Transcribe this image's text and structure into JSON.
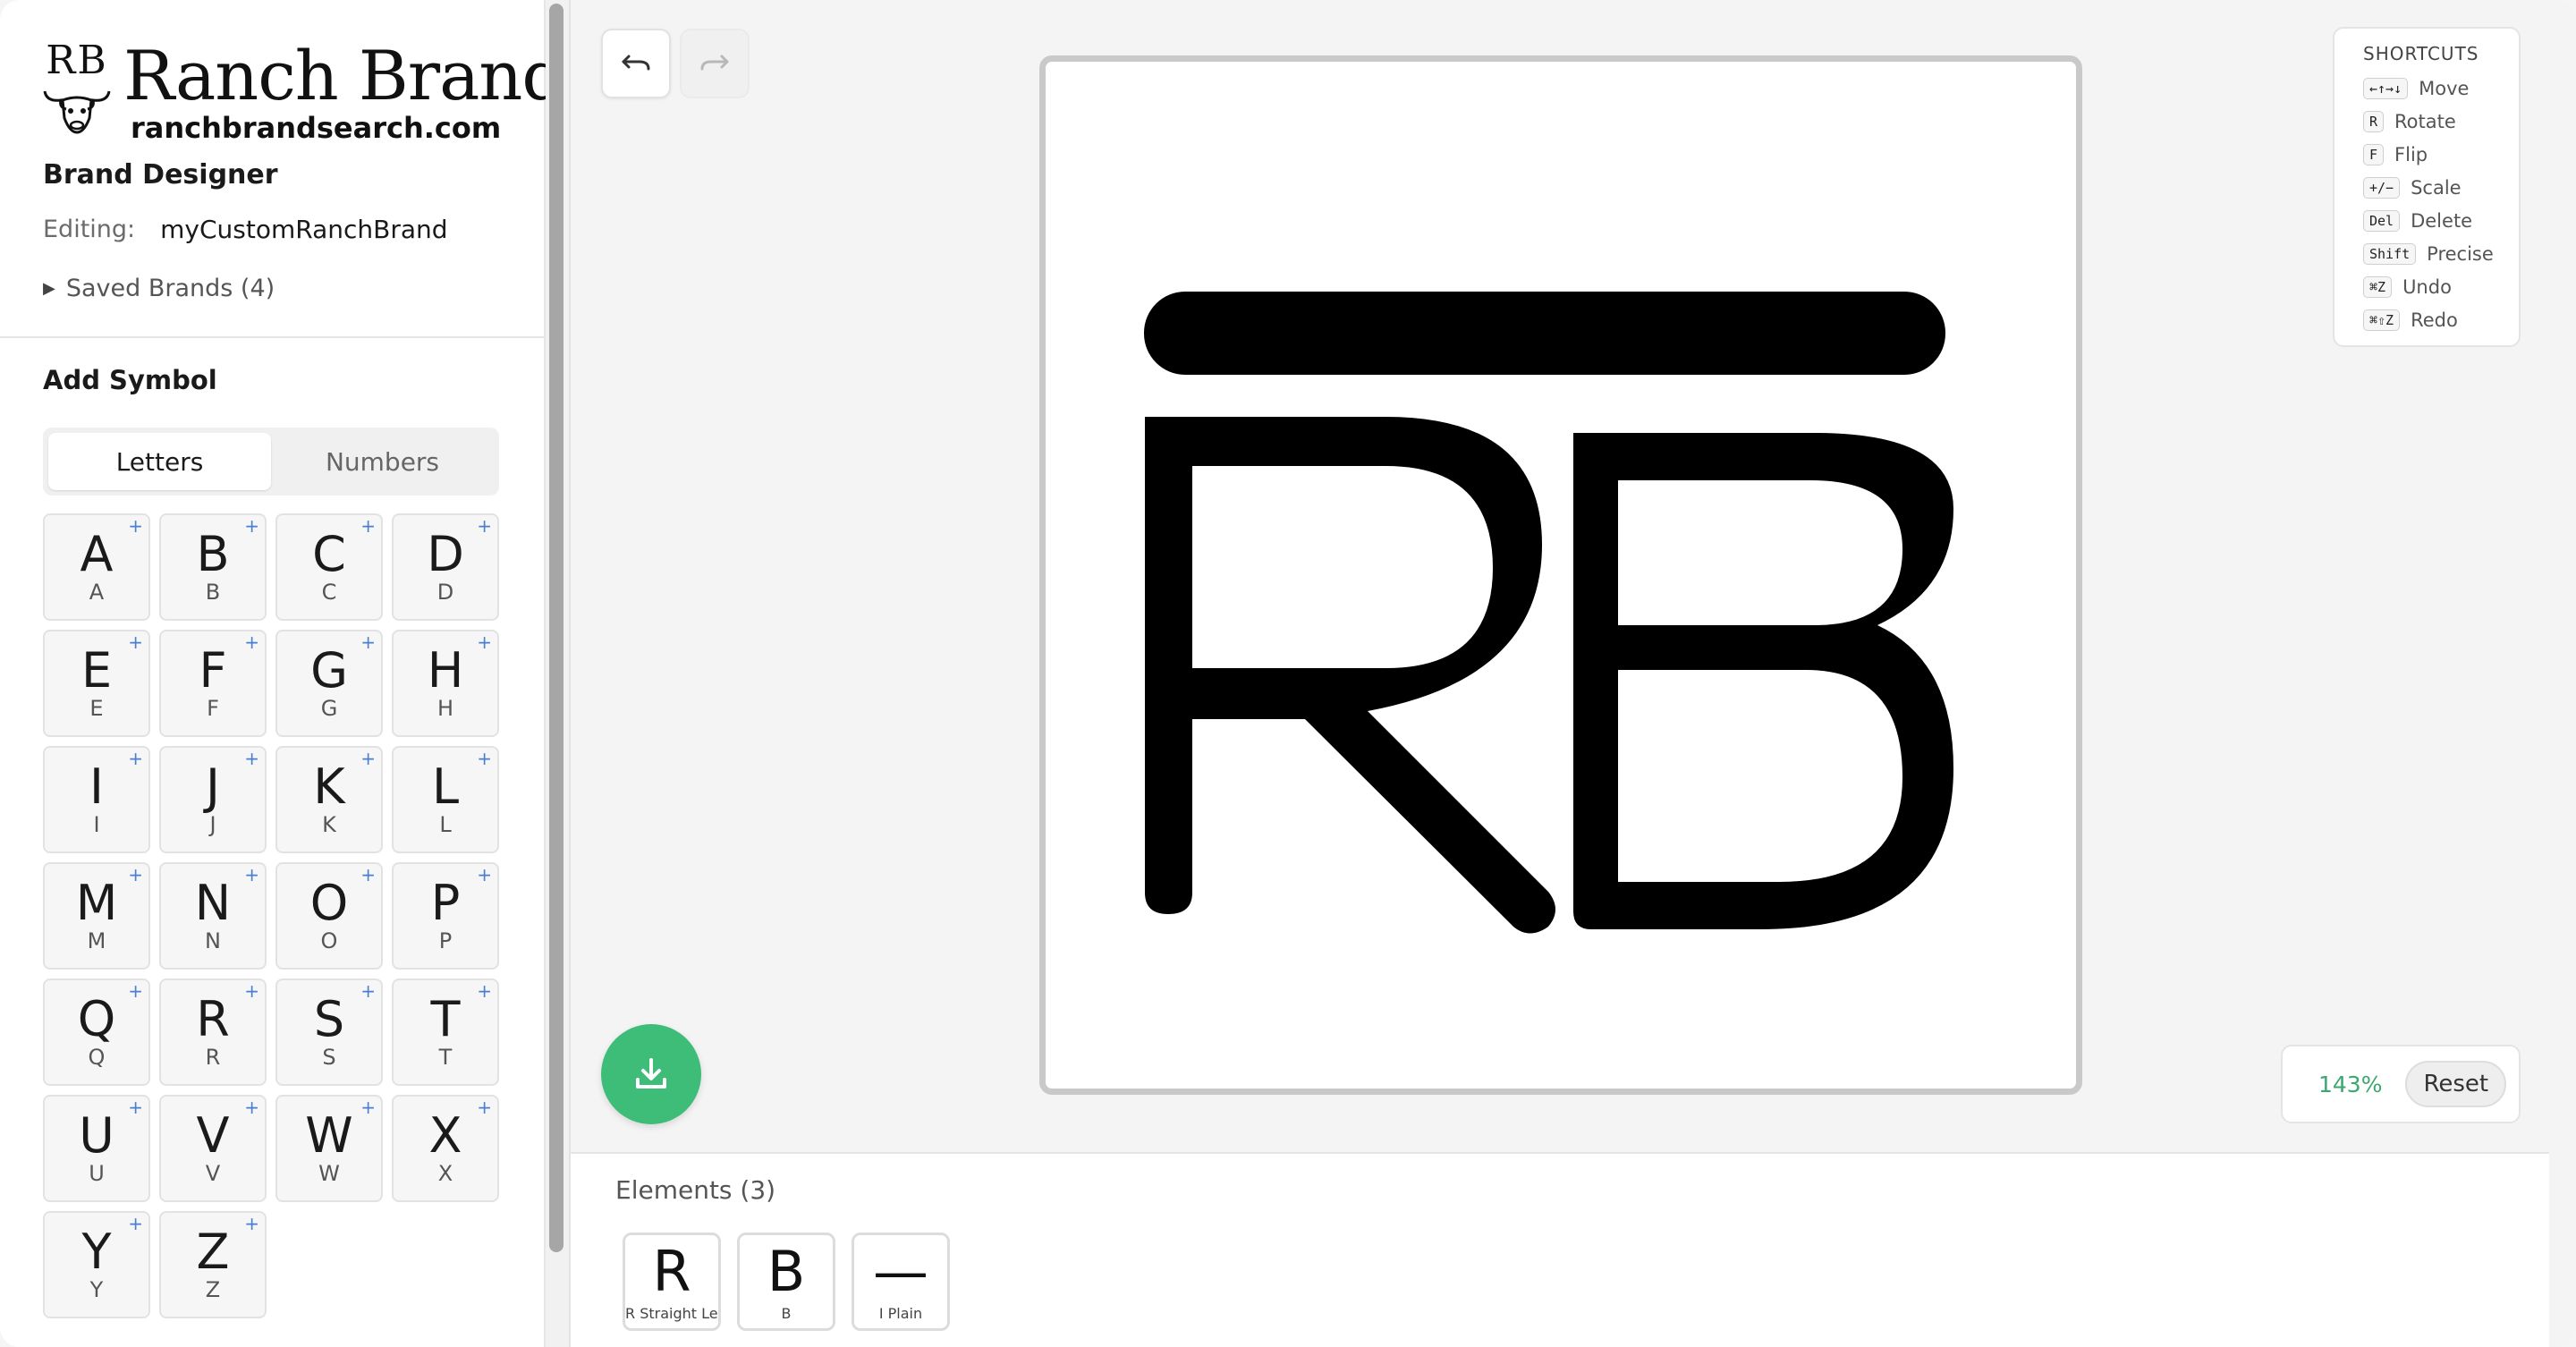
{
  "brand": {
    "mark": "RB",
    "name": "Ranch Brand",
    "url": "ranchbrandsearch.com"
  },
  "app_title": "Brand Designer",
  "editing": {
    "label": "Editing:",
    "value": "myCustomRanchBrand"
  },
  "saved_brands": "Saved Brands (4)",
  "add_symbol": {
    "title": "Add Symbol",
    "tabs": [
      {
        "label": "Letters",
        "active": true
      },
      {
        "label": "Numbers",
        "active": false
      }
    ],
    "letters": [
      "A",
      "B",
      "C",
      "D",
      "E",
      "F",
      "G",
      "H",
      "I",
      "J",
      "K",
      "L",
      "M",
      "N",
      "O",
      "P",
      "Q",
      "R",
      "S",
      "T",
      "U",
      "V",
      "W",
      "X",
      "Y",
      "Z"
    ]
  },
  "toolbar": {
    "undo_icon": "undo-icon",
    "redo_icon": "redo-icon"
  },
  "shortcuts": {
    "title": "SHORTCUTS",
    "items": [
      {
        "key": "←↑→↓",
        "label": "Move"
      },
      {
        "key": "R",
        "label": "Rotate"
      },
      {
        "key": "F",
        "label": "Flip"
      },
      {
        "key": "+/−",
        "label": "Scale"
      },
      {
        "key": "Del",
        "label": "Delete"
      },
      {
        "key": "Shift",
        "label": "Precise"
      },
      {
        "key": "⌘Z",
        "label": "Undo"
      },
      {
        "key": "⌘⇧Z",
        "label": "Redo"
      }
    ]
  },
  "zoom": {
    "value": "143%",
    "reset_label": "Reset"
  },
  "download_icon": "download-icon",
  "elements": {
    "title": "Elements (3)",
    "items": [
      {
        "glyph": "R",
        "caption": "R Straight Leg"
      },
      {
        "glyph": "B",
        "caption": "B"
      },
      {
        "glyph": "—",
        "caption": "I Plain"
      }
    ]
  },
  "colors": {
    "accent": "#3dbd78",
    "zoom_text": "#3aa86e",
    "plus": "#4a7fd0",
    "brand_ink": "#000000"
  }
}
